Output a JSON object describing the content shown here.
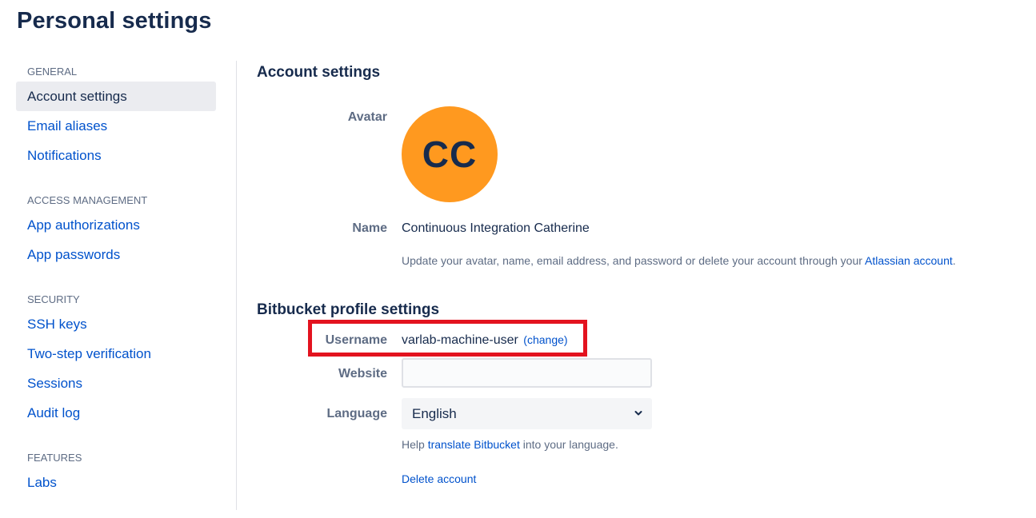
{
  "page": {
    "title": "Personal settings"
  },
  "sidebar": {
    "groups": [
      {
        "heading": "GENERAL",
        "items": [
          {
            "label": "Account settings",
            "selected": true
          },
          {
            "label": "Email aliases"
          },
          {
            "label": "Notifications"
          }
        ]
      },
      {
        "heading": "ACCESS MANAGEMENT",
        "items": [
          {
            "label": "App authorizations"
          },
          {
            "label": "App passwords"
          }
        ]
      },
      {
        "heading": "SECURITY",
        "items": [
          {
            "label": "SSH keys"
          },
          {
            "label": "Two-step verification"
          },
          {
            "label": "Sessions"
          },
          {
            "label": "Audit log"
          }
        ]
      },
      {
        "heading": "FEATURES",
        "items": [
          {
            "label": "Labs"
          }
        ]
      }
    ]
  },
  "account": {
    "section_title": "Account settings",
    "avatar_label": "Avatar",
    "avatar_initials": "CC",
    "avatar_color": "#ff991f",
    "name_label": "Name",
    "name_value": "Continuous Integration Catherine",
    "help_prefix": "Update your avatar, name, email address, and password or delete your account through your ",
    "help_link": "Atlassian account",
    "help_suffix": "."
  },
  "profile": {
    "section_title": "Bitbucket profile settings",
    "username_label": "Username",
    "username_value": "varlab-machine-user",
    "change_link": "(change)",
    "website_label": "Website",
    "website_value": "",
    "language_label": "Language",
    "language_value": "English",
    "language_help_prefix": "Help ",
    "language_help_link": "translate Bitbucket",
    "language_help_suffix": " into your language.",
    "delete_account": "Delete account"
  },
  "colors": {
    "link": "#0052cc",
    "text": "#172b4d",
    "muted": "#5e6c84",
    "highlight": "#e3131f",
    "selected_bg": "#ebecf0"
  },
  "icons": {
    "language_dropdown": "chevron-down-icon"
  }
}
